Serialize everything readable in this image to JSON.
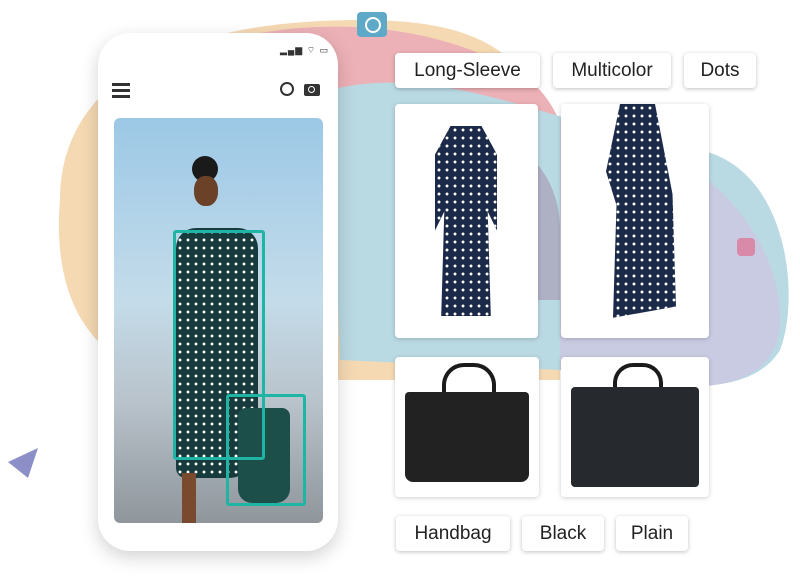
{
  "phone": {
    "status_icons": [
      "signal-icon",
      "wifi-icon",
      "battery-icon"
    ],
    "menu_icon": "hamburger-icon",
    "search_icon": "search-icon",
    "camera_icon": "camera-icon",
    "detections": [
      "dress",
      "handbag"
    ]
  },
  "top_tags": [
    "Long-Sleeve",
    "Multicolor",
    "Dots"
  ],
  "bottom_tags": [
    "Handbag",
    "Black",
    "Plain"
  ],
  "results": [
    "dress-flat",
    "dress-model",
    "handbag-black-1",
    "handbag-black-2"
  ],
  "colors": {
    "detection": "#1fb5a5",
    "pink": "#ecb1b6",
    "peach": "#f5d9b3",
    "blue": "#b9d9e3",
    "lavender": "#c9cbe3",
    "navy": "#1c2a4a"
  }
}
